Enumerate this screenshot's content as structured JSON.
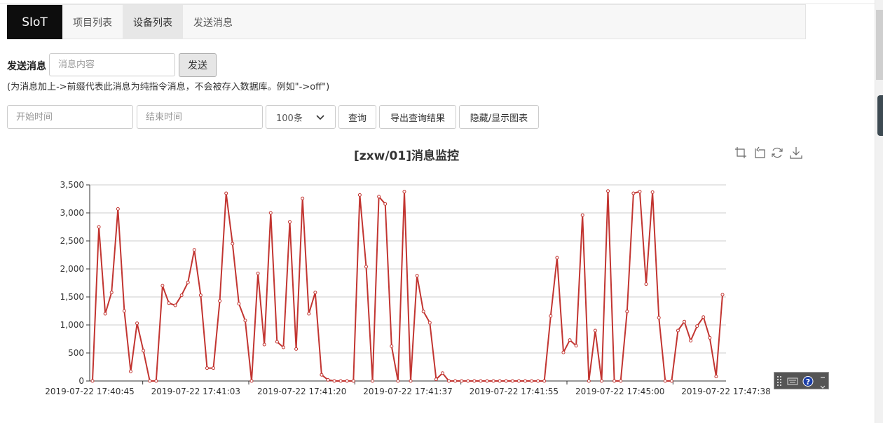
{
  "nav": {
    "brand": "SIoT",
    "items": [
      "项目列表",
      "设备列表",
      "发送消息"
    ],
    "active_index": 1
  },
  "send": {
    "label": "发送消息",
    "placeholder": "消息内容",
    "button": "发送",
    "hint": "(为消息加上->前缀代表此消息为纯指令消息，不会被存入数据库。例如\"->off\")"
  },
  "query": {
    "start_placeholder": "开始时间",
    "end_placeholder": "结束时间",
    "limit": "100条",
    "query_button": "查询",
    "export_button": "导出查询结果",
    "toggle_button": "隐藏/显示图表"
  },
  "colors": {
    "line": "#c23531",
    "grid": "#cccccc",
    "axis": "#333333"
  },
  "chart_data": {
    "type": "line",
    "title": "[zxw/01]消息监控",
    "xlabel": "",
    "ylabel": "",
    "ylim": [
      0,
      3500
    ],
    "yticks": [
      "0",
      "500",
      "1,000",
      "1,500",
      "2,000",
      "2,500",
      "3,000",
      "3,500"
    ],
    "xtick_labels": [
      "2019-07-22 17:40:45",
      "2019-07-22 17:41:03",
      "2019-07-22 17:41:20",
      "2019-07-22 17:41:37",
      "2019-07-22 17:41:55",
      "2019-07-22 17:45:00",
      "2019-07-22 17:47:38"
    ],
    "grid": true,
    "series": [
      {
        "values": [
          0,
          2750,
          1200,
          1580,
          3070,
          1250,
          170,
          1030,
          540,
          0,
          0,
          1700,
          1390,
          1350,
          1530,
          1760,
          2340,
          1530,
          230,
          230,
          1430,
          3350,
          2450,
          1380,
          1080,
          0,
          1920,
          650,
          3000,
          700,
          600,
          2840,
          570,
          3260,
          1200,
          1580,
          110,
          20,
          0,
          0,
          0,
          0,
          3320,
          2040,
          0,
          3290,
          3160,
          620,
          0,
          3380,
          0,
          1880,
          1240,
          1040,
          30,
          140,
          0,
          0,
          0,
          0,
          0,
          0,
          0,
          0,
          0,
          0,
          0,
          0,
          0,
          0,
          0,
          0,
          1160,
          2200,
          510,
          730,
          630,
          2960,
          0,
          900,
          0,
          3390,
          0,
          0,
          1240,
          3350,
          3380,
          1730,
          3370,
          1130,
          0,
          0,
          900,
          1060,
          720,
          980,
          1140,
          770,
          80,
          1540
        ]
      }
    ]
  }
}
